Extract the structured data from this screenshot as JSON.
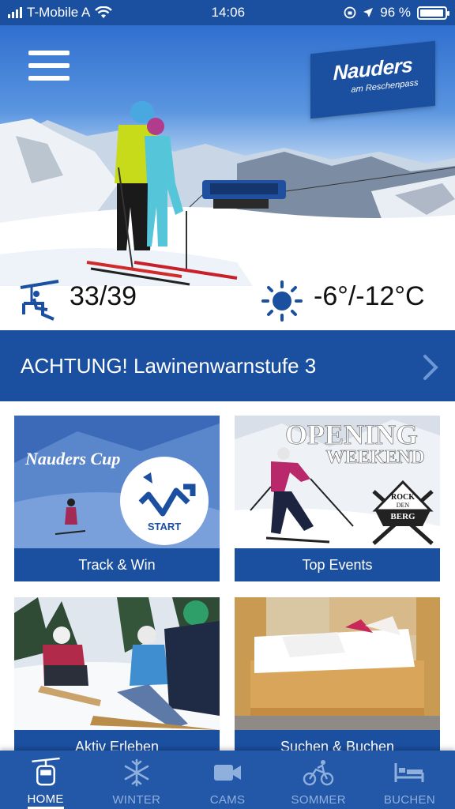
{
  "status_bar": {
    "carrier": "T-Mobile A",
    "time": "14:06",
    "battery": "96 %",
    "battery_level": 0.96
  },
  "header": {
    "logo_title": "Nauders",
    "logo_subtitle": "am Reschenpass",
    "menu_icon": "hamburger-menu-icon"
  },
  "stats": {
    "lifts": "33/39",
    "temperature": "-6°/-12°C",
    "lift_icon": "chairlift-icon",
    "weather_icon": "sun-icon"
  },
  "alert": {
    "text": "ACHTUNG! Lawinenwarnstufe 3"
  },
  "tiles": [
    {
      "label": "Track & Win",
      "image_text": "Nauders Cup",
      "badge": "START"
    },
    {
      "label": "Top Events",
      "image_text_1": "OPENING",
      "image_text_2": "WEEKEND",
      "badge_1": "ROCK",
      "badge_2": "DEN",
      "badge_3": "BERG"
    },
    {
      "label": "Aktiv Erleben"
    },
    {
      "label": "Suchen & Buchen"
    }
  ],
  "tabs": [
    {
      "label": "HOME",
      "icon": "gondola-icon",
      "active": true
    },
    {
      "label": "WINTER",
      "icon": "snowflake-icon",
      "active": false
    },
    {
      "label": "CAMS",
      "icon": "video-camera-icon",
      "active": false
    },
    {
      "label": "SOMMER",
      "icon": "bicycle-icon",
      "active": false
    },
    {
      "label": "BUCHEN",
      "icon": "bed-icon",
      "active": false
    }
  ],
  "colors": {
    "brand_blue": "#1b4fa0",
    "tabbar_blue": "#2357a8",
    "tab_inactive": "#8fb0dd"
  }
}
